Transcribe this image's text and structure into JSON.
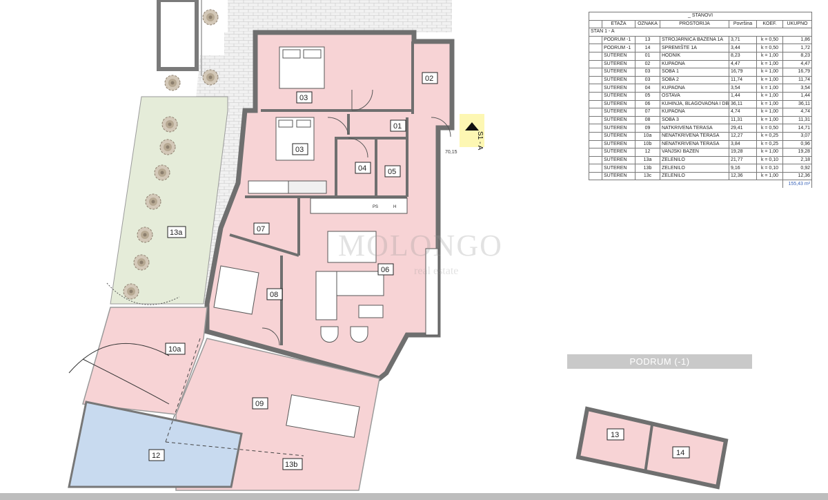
{
  "table": {
    "title": "_ STANOVI",
    "headers": [
      "ETAŽA",
      "OZNAKA",
      "PROSTORIJA",
      "Površina",
      "KOEF.",
      "UKUPNO"
    ],
    "group_label": "STAN 1 - A",
    "rows": [
      [
        "PODRUM -1",
        "13",
        "STROJARNICA BAZENA 1A",
        "3,71",
        "k = 0,50",
        "1,86"
      ],
      [
        "PODRUM -1",
        "14",
        "SPREMIŠTE 1A",
        "3,44",
        "k = 0,50",
        "1,72"
      ],
      [
        "SUTEREN",
        "01",
        "HODNIK",
        "8,23",
        "k = 1,00",
        "8,23"
      ],
      [
        "SUTEREN",
        "02",
        "KUPAONA",
        "4,47",
        "k = 1,00",
        "4,47"
      ],
      [
        "SUTEREN",
        "03",
        "SOBA 1",
        "16,79",
        "k = 1,00",
        "16,79"
      ],
      [
        "SUTEREN",
        "03",
        "SOBA 2",
        "11,74",
        "k = 1,00",
        "11,74"
      ],
      [
        "SUTEREN",
        "04",
        "KUPAONA",
        "3,54",
        "k = 1,00",
        "3,54"
      ],
      [
        "SUTEREN",
        "05",
        "OSTAVA",
        "1,44",
        "k = 1,00",
        "1,44"
      ],
      [
        "SUTEREN",
        "06",
        "KUHINJA, BLAGOVAONA I DB",
        "36,11",
        "k = 1,00",
        "36,11"
      ],
      [
        "SUTEREN",
        "07",
        "KUPAONA",
        "4,74",
        "k = 1,00",
        "4,74"
      ],
      [
        "SUTEREN",
        "08",
        "SOBA 3",
        "11,31",
        "k = 1,00",
        "11,31"
      ],
      [
        "SUTEREN",
        "09",
        "NATKRIVENA TERASA",
        "29,41",
        "k = 0,50",
        "14,71"
      ],
      [
        "SUTEREN",
        "10a",
        "NENATKRIVENA TERASA",
        "12,27",
        "k = 0,25",
        "3,07"
      ],
      [
        "SUTEREN",
        "10b",
        "NENATKRIVENA TERASA",
        "3,84",
        "k = 0,25",
        "0,96"
      ],
      [
        "SUTEREN",
        "12",
        "VANJSKI BAZEN",
        "19,28",
        "k = 1,00",
        "19,28"
      ],
      [
        "SUTEREN",
        "13a",
        "ZELENILO",
        "21,77",
        "k = 0,10",
        "2,18"
      ],
      [
        "SUTEREN",
        "13b",
        "ZELENILO",
        "9,16",
        "k = 0,10",
        "0,92"
      ],
      [
        "SUTEREN",
        "13c",
        "ZELENILO",
        "12,36",
        "k = 1,00",
        "12,36"
      ]
    ],
    "total": "155,43 m²"
  },
  "podrum_label": "PODRUM (-1)",
  "section_marker": "S1 - A",
  "level_mark": "70,15",
  "watermark": "MOLONGO",
  "watermark_sub": "real estate",
  "fixture_labels": {
    "ps": "PS",
    "h": "H"
  },
  "room_labels": {
    "r03a": "03",
    "r02": "02",
    "r01": "01",
    "r03b": "03",
    "r04": "04",
    "r05": "05",
    "r07": "07",
    "r06": "06",
    "r08": "08",
    "r13a": "13a",
    "r10a": "10a",
    "r09": "09",
    "r12": "12",
    "r13b": "13b",
    "r13": "13",
    "r14": "14"
  },
  "colors": {
    "room_fill": "#f6d2d4",
    "pool_fill": "#c7d9ef",
    "wall": "#7a7a7a",
    "green_fill": "#e4ecd8",
    "paving": "#eeeeee"
  }
}
